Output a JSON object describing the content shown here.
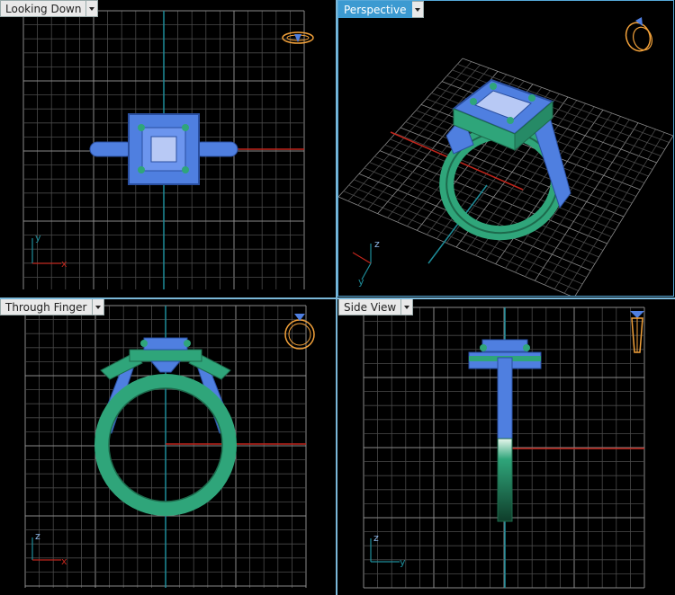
{
  "viewports": [
    {
      "label": "Looking Down",
      "axes": [
        "y",
        "x"
      ],
      "active": false
    },
    {
      "label": "Perspective",
      "axes": [
        "z",
        "y"
      ],
      "active": true
    },
    {
      "label": "Through Finger",
      "axes": [
        "z",
        "x"
      ],
      "active": false
    },
    {
      "label": "Side View",
      "axes": [
        "z",
        "y"
      ],
      "active": false
    }
  ],
  "colors": {
    "grid": "#5a5a5a",
    "grid_bg": "#000000",
    "axis_x": "#c0261c",
    "axis_y": "#1e8c99",
    "ring_blue": "#4f7fe0",
    "ring_green": "#2fa57a",
    "gizmo_orange": "#f2a13a",
    "active_border": "#56a8d8"
  },
  "icons": [
    "dropdown-arrow-icon",
    "ring-orientation-gizmo-icon"
  ]
}
